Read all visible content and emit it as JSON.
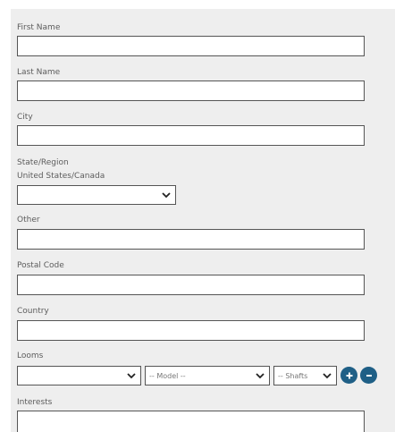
{
  "form": {
    "first_name": {
      "label": "First Name",
      "value": ""
    },
    "last_name": {
      "label": "Last Name",
      "value": ""
    },
    "city": {
      "label": "City",
      "value": ""
    },
    "state_region": {
      "label": "State/Region",
      "sublabel": "United States/Canada",
      "selected": ""
    },
    "other": {
      "label": "Other",
      "value": ""
    },
    "postal_code": {
      "label": "Postal Code",
      "value": ""
    },
    "country": {
      "label": "Country",
      "value": ""
    },
    "looms": {
      "label": "Looms",
      "loom_selected": "",
      "model_selected": "-- Model --",
      "shafts_selected": "-- Shafts"
    },
    "interests": {
      "label": "Interests",
      "value": ""
    }
  },
  "icons": {
    "dropdown": "chevron-down-icon",
    "add": "plus-icon",
    "remove": "minus-icon"
  },
  "colors": {
    "panel_bg": "#eeeeee",
    "border": "#555555",
    "button": "#1f5f86"
  }
}
